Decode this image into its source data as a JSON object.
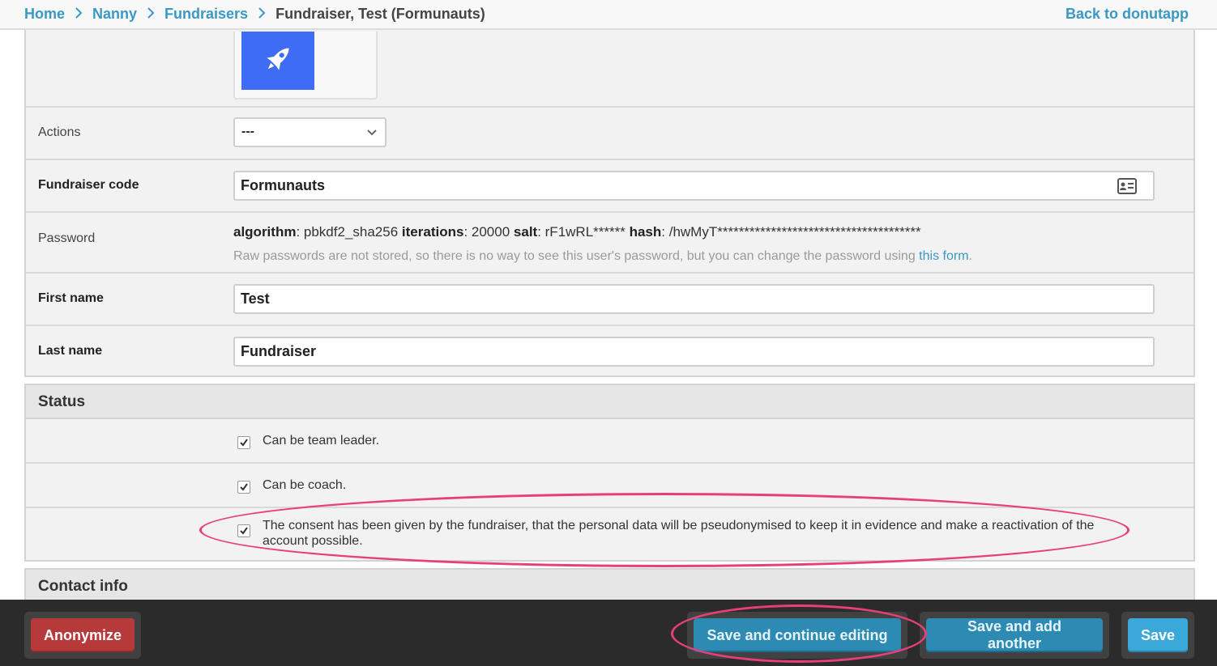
{
  "breadcrumbs": {
    "items": [
      "Home",
      "Nanny",
      "Fundraisers"
    ],
    "current": "Fundraiser, Test (Formunauts)"
  },
  "back_link": "Back to donutapp",
  "form": {
    "actions": {
      "label": "Actions",
      "value": "---"
    },
    "fundraiser_code": {
      "label": "Fundraiser code",
      "value": "Formunauts"
    },
    "password": {
      "label": "Password",
      "algorithm_key": "algorithm",
      "algorithm_value": ": pbkdf2_sha256",
      "iterations_key": "iterations",
      "iterations_value": ": 20000",
      "salt_key": "salt",
      "salt_value": ": rF1wRL******",
      "hash_key": "hash",
      "hash_value": ": /hwMyT**************************************",
      "help_text": "Raw passwords are not stored, so there is no way to see this user's password, but you can change the password using ",
      "help_link": "this form",
      "help_end": "."
    },
    "first_name": {
      "label": "First name",
      "value": "Test"
    },
    "last_name": {
      "label": "Last name",
      "value": "Fundraiser"
    }
  },
  "status": {
    "title": "Status",
    "checkboxes": [
      {
        "label": "Can be team leader.",
        "checked": true
      },
      {
        "label": "Can be coach.",
        "checked": true
      },
      {
        "label": "The consent has been given by the fundraiser, that the personal data will be pseudonymised to keep it in evidence and make a reactivation of the account possible.",
        "checked": true
      }
    ]
  },
  "contact_info": {
    "title": "Contact info"
  },
  "submit_bar": {
    "anonymize": "Anonymize",
    "save_continue": "Save and continue editing",
    "save_add": "Save and add another",
    "save": "Save"
  },
  "colors": {
    "link": "#3a98c5",
    "avatar_bg": "#3e6cf4",
    "danger": "#b73a3a",
    "primary": "#3ba8da",
    "annotation": "#e83f78"
  },
  "icons": {
    "avatar": "rocket-icon",
    "select": "chevron-down-icon",
    "input": "contact-card-icon",
    "breadcrumb_separator": "chevron-right-icon",
    "checkbox": "checkmark-icon"
  }
}
